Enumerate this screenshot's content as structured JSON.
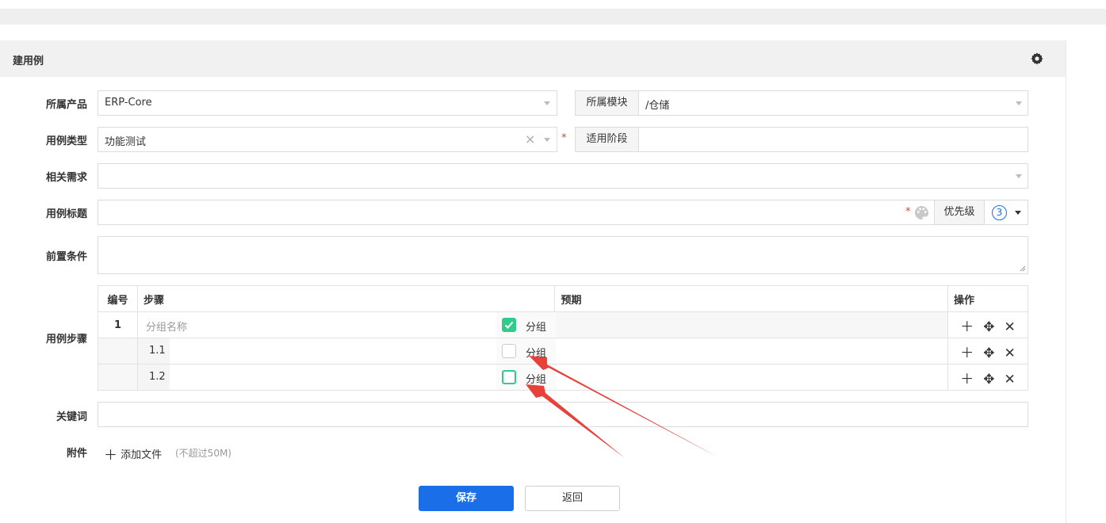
{
  "header": {
    "title": "建用例"
  },
  "fields": {
    "product": {
      "label": "所属产品",
      "value": "ERP-Core"
    },
    "module": {
      "label": "所属模块",
      "value": "/仓储"
    },
    "type": {
      "label": "用例类型",
      "value": "功能测试",
      "clear": "×"
    },
    "stage": {
      "label": "适用阶段",
      "value": ""
    },
    "story": {
      "label": "相关需求",
      "value": ""
    },
    "title": {
      "label": "用例标题",
      "value": ""
    },
    "priority": {
      "label": "优先级",
      "value": "3"
    },
    "precondition": {
      "label": "前置条件",
      "value": ""
    },
    "steps_label": "用例步骤",
    "keywords": {
      "label": "关键词",
      "value": ""
    },
    "attachment": {
      "label": "附件",
      "add": "添加文件",
      "hint": "(不超过50M)"
    }
  },
  "required_mark": "*",
  "steps_table": {
    "headers": [
      "编号",
      "步骤",
      "预期",
      "操作"
    ],
    "group_label": "分组",
    "rows": [
      {
        "num": "1",
        "subnum": "",
        "step": "",
        "placeholder": "分组名称",
        "checked": true
      },
      {
        "num": "",
        "subnum": "1.1",
        "step": "",
        "placeholder": "",
        "checked": false
      },
      {
        "num": "",
        "subnum": "1.2",
        "step": "",
        "placeholder": "",
        "checked": false
      }
    ]
  },
  "buttons": {
    "save": "保存",
    "back": "返回"
  },
  "colors": {
    "primary": "#1a6fe8",
    "check": "#2fcc8b",
    "required": "#e03c3c",
    "arrow": "#e8413a"
  },
  "icons": [
    "gear-icon",
    "palette-icon",
    "plus-icon",
    "move-icon",
    "close-icon",
    "check-icon"
  ]
}
